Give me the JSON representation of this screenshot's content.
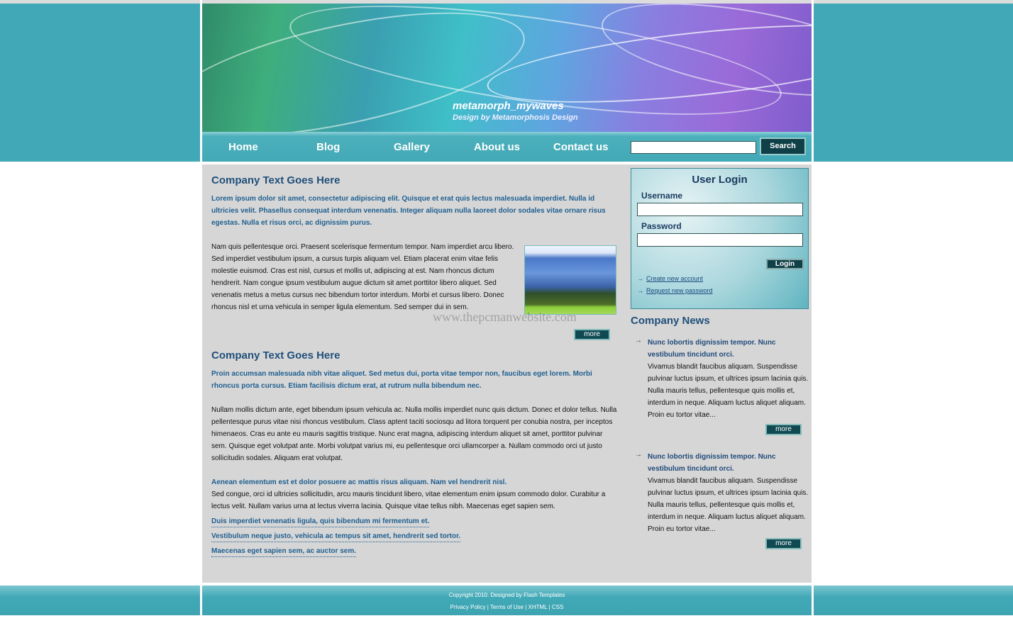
{
  "header": {
    "title": "metamorph_mywaves",
    "subtitle": "Design by Metamorphosis Design"
  },
  "nav": {
    "items": [
      "Home",
      "Blog",
      "Gallery",
      "About us",
      "Contact us"
    ],
    "search_value": "",
    "search_label": "Search"
  },
  "main": {
    "section1": {
      "title": "Company Text Goes Here",
      "lead": "Lorem ipsum dolor sit amet, consectetur adipiscing elit. Quisque et erat quis lectus malesuada imperdiet. Nulla id ultricies velit. Phasellus consequat interdum venenatis. Integer aliquam nulla laoreet dolor sodales vitae ornare risus egestas. Nulla et risus orci, ac dignissim purus.",
      "body": "Nam quis pellentesque orci. Praesent scelerisque fermentum tempor. Nam imperdiet arcu libero. Sed imperdiet vestibulum ipsum, a cursus turpis aliquam vel. Etiam placerat enim vitae felis molestie euismod. Cras est nisl, cursus et mollis ut, adipiscing at est. Nam rhoncus dictum hendrerit. Nam congue ipsum vestibulum augue dictum sit amet porttitor libero aliquet. Sed venenatis metus a metus cursus nec bibendum tortor interdum. Morbi et cursus libero. Donec rhoncus nisl et urna vehicula in semper ligula elementum. Sed semper dui in sem.",
      "more": "more",
      "watermark": "www.thepcmanwebsite.com"
    },
    "section2": {
      "title": "Company Text Goes Here",
      "lead": "Proin accumsan malesuada nibh vitae aliquet. Sed metus dui, porta vitae tempor non, faucibus eget lorem. Morbi rhoncus porta cursus. Etiam facilisis dictum erat, at rutrum nulla bibendum nec.",
      "body": "Nullam mollis dictum ante, eget bibendum ipsum vehicula ac. Nulla mollis imperdiet nunc quis dictum. Donec et dolor tellus. Nulla pellentesque purus vitae nisi rhoncus vestibulum. Class aptent taciti sociosqu ad litora torquent per conubia nostra, per inceptos himenaeos. Cras eu ante eu mauris sagittis tristique. Nunc erat magna, adipiscing interdum aliquet sit amet, porttitor pulvinar sem. Quisque eget volutpat ante. Morbi volutpat varius mi, eu pellentesque orci ullamcorper a. Nullam commodo orci ut justo sollicitudin sodales. Aliquam erat volutpat.",
      "sub_lead": "Aenean elementum est et dolor posuere ac mattis risus aliquam. Nam vel hendrerit nisl.",
      "sub_body": "Sed congue, orci id ultricies sollicitudin, arcu mauris tincidunt libero, vitae elementum enim ipsum commodo dolor. Curabitur a lectus velit. Nullam varius urna at lectus viverra lacinia. Quisque vitae tellus nibh. Maecenas eget sapien sem.",
      "links": [
        "Duis imperdiet venenatis ligula, quis bibendum mi fermentum et.",
        "Vestibulum neque justo, vehicula ac tempus sit amet, hendrerit sed tortor.",
        "Maecenas eget sapien sem, ac auctor sem."
      ]
    }
  },
  "login": {
    "title": "User Login",
    "username_label": "Username",
    "password_label": "Password",
    "username_value": "",
    "password_value": "",
    "button": "Login",
    "create_account": "Create new account",
    "request_password": "Request new password"
  },
  "news": {
    "title": "Company News",
    "items": [
      {
        "title": "Nunc lobortis dignissim tempor. Nunc vestibulum tincidunt orci.",
        "desc": "Vivamus blandit faucibus aliquam. Suspendisse pulvinar luctus ipsum, et ultrices ipsum lacinia quis. Nulla mauris tellus, pellentesque quis mollis et, interdum in neque. Aliquam luctus aliquet aliquam. Proin eu tortor vitae...",
        "more": "more"
      },
      {
        "title": "Nunc lobortis dignissim tempor. Nunc vestibulum tincidunt orci.",
        "desc": "Vivamus blandit faucibus aliquam. Suspendisse pulvinar luctus ipsum, et ultrices ipsum lacinia quis. Nulla mauris tellus, pellentesque quis mollis et, interdum in neque. Aliquam luctus aliquet aliquam. Proin eu tortor vitae...",
        "more": "more"
      }
    ]
  },
  "footer": {
    "copyright": "Copyright 2010. Designed by Flash Templates",
    "links": [
      "Privacy Policy",
      "Terms of Use",
      "XHTML",
      "CSS"
    ],
    "separator": " | "
  },
  "colors": {
    "teal": "#40a8b6",
    "button": "#0f4048",
    "heading": "#1f4f7a",
    "content_bg": "#d6d6d6"
  }
}
